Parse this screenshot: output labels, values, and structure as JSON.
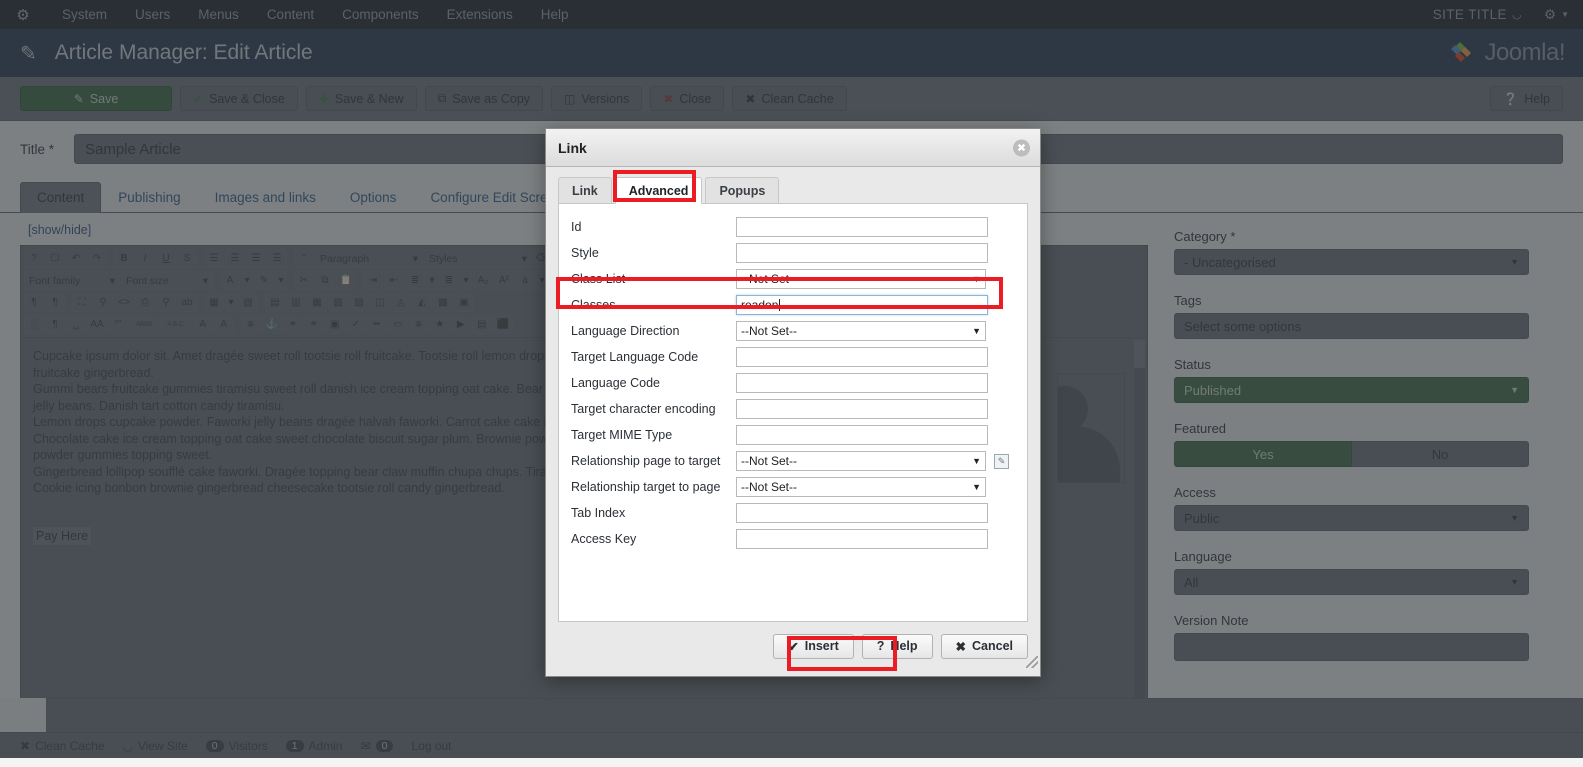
{
  "topbar": {
    "brand_icon": "joomla-logo-icon",
    "menus": [
      "System",
      "Users",
      "Menus",
      "Content",
      "Components",
      "Extensions",
      "Help"
    ],
    "site_title": "SITE TITLE",
    "external_icon": "external-link-icon",
    "gear_icon": "gear-icon",
    "caret_icon": "chevron-down-icon"
  },
  "header": {
    "icon": "pencil-icon",
    "title": "Article Manager: Edit Article",
    "logo_text": "Joomla!"
  },
  "toolbar": {
    "buttons": [
      {
        "label": "Save",
        "icon": "save-icon",
        "primary": true
      },
      {
        "label": "Save & Close",
        "icon": "check-icon",
        "primary": false
      },
      {
        "label": "Save & New",
        "icon": "plus-icon",
        "primary": false
      },
      {
        "label": "Save as Copy",
        "icon": "copy-icon",
        "primary": false
      },
      {
        "label": "Versions",
        "icon": "archive-icon",
        "primary": false
      },
      {
        "label": "Close",
        "icon": "close-circle-icon",
        "primary": false
      },
      {
        "label": "Clean Cache",
        "icon": "broom-icon",
        "primary": false
      }
    ],
    "help": {
      "label": "Help",
      "icon": "help-circle-icon"
    }
  },
  "article": {
    "title_label": "Title *",
    "title_value": "Sample Article",
    "tabs": [
      "Content",
      "Publishing",
      "Images and links",
      "Options",
      "Configure Edit Screen"
    ],
    "active_tab": "Content",
    "showhide": "[show/hide]"
  },
  "editor": {
    "toolbar_row1": [
      {
        "icon": "help-icon",
        "label": "?"
      },
      {
        "icon": "new-document-icon",
        "label": "☐"
      },
      {
        "icon": "undo-icon",
        "label": "↶"
      },
      {
        "icon": "redo-icon",
        "label": "↷"
      },
      {
        "icon": "bold-icon",
        "label": "B"
      },
      {
        "icon": "italic-icon",
        "label": "I"
      },
      {
        "icon": "underline-icon",
        "label": "U"
      },
      {
        "icon": "strikethrough-icon",
        "label": "S"
      },
      {
        "icon": "align-left-icon",
        "label": "≡"
      },
      {
        "icon": "align-center-icon",
        "label": "≡"
      },
      {
        "icon": "align-right-icon",
        "label": "≡"
      },
      {
        "icon": "align-justify-icon",
        "label": "≡"
      },
      {
        "icon": "blockquote-icon",
        "label": "“"
      }
    ],
    "dropdown_paragraph": "Paragraph",
    "dropdown_styles": "Styles",
    "dropdown_fontfamily": "Font family",
    "dropdown_fontsize": "Font size",
    "toolbar_row2": [
      {
        "icon": "eraser-icon",
        "label": "⊘"
      },
      {
        "icon": "text-color-icon",
        "label": "A"
      },
      {
        "icon": "highlight-color-icon",
        "label": "✎"
      },
      {
        "icon": "cut-icon",
        "label": "✂"
      },
      {
        "icon": "copy-icon",
        "label": "⧉"
      },
      {
        "icon": "paste-icon",
        "label": "Ὄb"
      },
      {
        "icon": "indent-icon",
        "label": "⇥"
      },
      {
        "icon": "outdent-icon",
        "label": "⇤"
      },
      {
        "icon": "numbered-list-icon",
        "label": "≣"
      },
      {
        "icon": "bullet-list-icon",
        "label": "≣"
      },
      {
        "icon": "subscript-icon",
        "label": "A₂"
      },
      {
        "icon": "superscript-icon",
        "label": "A²"
      },
      {
        "icon": "special-char-icon",
        "label": "a"
      },
      {
        "icon": "omega-icon",
        "label": "Ω"
      }
    ],
    "toolbar_row3": [
      {
        "icon": "ltr-icon",
        "label": "¶"
      },
      {
        "icon": "rtl-icon",
        "label": "¶"
      },
      {
        "icon": "fullscreen-icon",
        "label": "⛶"
      },
      {
        "icon": "preview-icon",
        "label": "⌕"
      },
      {
        "icon": "source-code-icon",
        "label": "<>"
      },
      {
        "icon": "print-icon",
        "label": "⎙"
      },
      {
        "icon": "search-replace-icon",
        "label": "⌕"
      },
      {
        "icon": "replace-icon",
        "label": "ab"
      },
      {
        "icon": "table-icon",
        "label": "⊞"
      },
      {
        "icon": "delete-table-icon",
        "label": "⊟"
      },
      {
        "icon": "row-props-icon",
        "label": "▤"
      },
      {
        "icon": "cell-props-icon",
        "label": "▥"
      },
      {
        "icon": "insert-row-before-icon",
        "label": "▦"
      },
      {
        "icon": "insert-row-after-icon",
        "label": "▧"
      },
      {
        "icon": "delete-row-icon",
        "label": "▨"
      },
      {
        "icon": "insert-col-before-icon",
        "label": "◫"
      },
      {
        "icon": "insert-col-after-icon",
        "label": "◬"
      },
      {
        "icon": "delete-col-icon",
        "label": "◭"
      },
      {
        "icon": "split-cell-icon",
        "label": "▩"
      },
      {
        "icon": "merge-cell-icon",
        "label": "▣"
      }
    ],
    "toolbar_row4": [
      {
        "icon": "visual-aid-icon",
        "label": "░"
      },
      {
        "icon": "paragraph-mark-icon",
        "label": "¶"
      },
      {
        "icon": "nonbreaking-icon",
        "label": "␣"
      },
      {
        "icon": "text-case-icon",
        "label": "AA"
      },
      {
        "icon": "quote-icon",
        "label": "“”"
      },
      {
        "icon": "abbr-icon",
        "label": "ABBR"
      },
      {
        "icon": "acronym-icon",
        "label": "A.B.C."
      },
      {
        "icon": "del-icon",
        "label": "A"
      },
      {
        "icon": "ins-icon",
        "label": "A"
      },
      {
        "icon": "template-icon",
        "label": "⎘"
      },
      {
        "icon": "anchor-icon",
        "label": "⚓"
      },
      {
        "icon": "unlink-icon",
        "label": "⛓"
      },
      {
        "icon": "link-icon",
        "label": "⚭"
      },
      {
        "icon": "image-icon",
        "label": "Ὓc"
      },
      {
        "icon": "spellcheck-icon",
        "label": "abc"
      },
      {
        "icon": "horizontal-rule-icon",
        "label": "—"
      },
      {
        "icon": "page-break-icon",
        "label": "▭"
      },
      {
        "icon": "readmore-icon",
        "label": "⎘"
      },
      {
        "icon": "image-manager-icon",
        "label": "★"
      },
      {
        "icon": "media-icon",
        "label": "▶"
      },
      {
        "icon": "article-icon",
        "label": "▤"
      },
      {
        "icon": "module-icon",
        "label": "⬛"
      }
    ],
    "body_paragraphs": [
      "Cupcake ipsum dolor sit. Amet dragée sweet roll tootsie roll fruitcake. Tootsie roll lemon drops g",
      "fruitcake gingerbread.",
      "Gummi bears fruitcake gummies tiramisu sweet roll danish ice cream topping oat cake. Bear claw",
      "jelly beans. Danish tart cotton candy tiramisu.",
      "Lemon drops cupcake powder. Faworki jelly beans dragée halvah faworki. Carrot cake cake icing",
      "Chocolate cake ice cream topping oat cake sweet chocolate biscuit sugar plum. Brownie powder",
      "powder gummies topping sweet.",
      "Gingerbread lollipop soufflé cake faworki. Dragée topping bear claw muffin chupa chups. Tiram",
      "Cookie icing bonbon brownie gingerbread cheesecake tootsie roll candy gingerbread."
    ],
    "link_text": "Pay Here",
    "avatar_icon": "user-placeholder-image"
  },
  "sidebar": {
    "category_label": "Category *",
    "category_value": "- Uncategorised",
    "tags_label": "Tags",
    "tags_placeholder": "Select some options",
    "status_label": "Status",
    "status_value": "Published",
    "featured_label": "Featured",
    "featured_yes": "Yes",
    "featured_no": "No",
    "featured_selected": "Yes",
    "access_label": "Access",
    "access_value": "Public",
    "language_label": "Language",
    "language_value": "All",
    "version_note_label": "Version Note",
    "version_note_value": ""
  },
  "statusbar": {
    "items": [
      {
        "icon": "broom-icon",
        "label": "Clean Cache"
      },
      {
        "icon": "external-link-icon",
        "label": "View Site"
      },
      {
        "icon": "visitors-icon",
        "label": "Visitors",
        "count": "0"
      },
      {
        "icon": "admin-icon",
        "label": "Admin",
        "count": "1"
      },
      {
        "icon": "messages-icon",
        "label": "",
        "count": "0"
      },
      {
        "icon": "logout-icon",
        "label": "Log out"
      }
    ]
  },
  "modal": {
    "title": "Link",
    "close_icon": "close-icon",
    "tabs": [
      {
        "label": "Link",
        "active": false
      },
      {
        "label": "Advanced",
        "active": true
      },
      {
        "label": "Popups",
        "active": false
      }
    ],
    "fields": [
      {
        "label": "Id",
        "type": "text",
        "value": "",
        "name": "id-field"
      },
      {
        "label": "Style",
        "type": "text",
        "value": "",
        "name": "style-field"
      },
      {
        "label": "Class List",
        "type": "select",
        "value": "--Not Set--",
        "name": "class-list-select"
      },
      {
        "label": "Classes",
        "type": "text",
        "value": "readon",
        "name": "classes-field",
        "focused": true
      },
      {
        "label": "Language Direction",
        "type": "select",
        "value": "--Not Set--",
        "name": "language-direction-select"
      },
      {
        "label": "Target Language Code",
        "type": "text",
        "value": "",
        "name": "target-language-code-field"
      },
      {
        "label": "Language Code",
        "type": "text",
        "value": "",
        "name": "language-code-field"
      },
      {
        "label": "Target character encoding",
        "type": "text",
        "value": "",
        "name": "target-character-encoding-field"
      },
      {
        "label": "Target MIME Type",
        "type": "text",
        "value": "",
        "name": "target-mime-type-field"
      },
      {
        "label": "Relationship page to target",
        "type": "select",
        "value": "--Not Set--",
        "name": "relationship-page-to-target-select",
        "extra_icon": "edit-icon"
      },
      {
        "label": "Relationship target to page",
        "type": "select",
        "value": "--Not Set--",
        "name": "relationship-target-to-page-select"
      },
      {
        "label": "Tab Index",
        "type": "text",
        "value": "",
        "name": "tab-index-field"
      },
      {
        "label": "Access Key",
        "type": "text",
        "value": "",
        "name": "access-key-field"
      }
    ],
    "buttons": [
      {
        "label": "Insert",
        "icon": "check-icon",
        "name": "insert-button"
      },
      {
        "label": "Help",
        "icon": "question-icon",
        "name": "help-button"
      },
      {
        "label": "Cancel",
        "icon": "x-icon",
        "name": "cancel-button"
      }
    ],
    "resize_handle": "resize-grip-icon"
  },
  "annotations": {
    "highlight_color": "#ec1c24",
    "boxes": [
      "advanced-tab",
      "classes-field",
      "insert-button"
    ]
  }
}
